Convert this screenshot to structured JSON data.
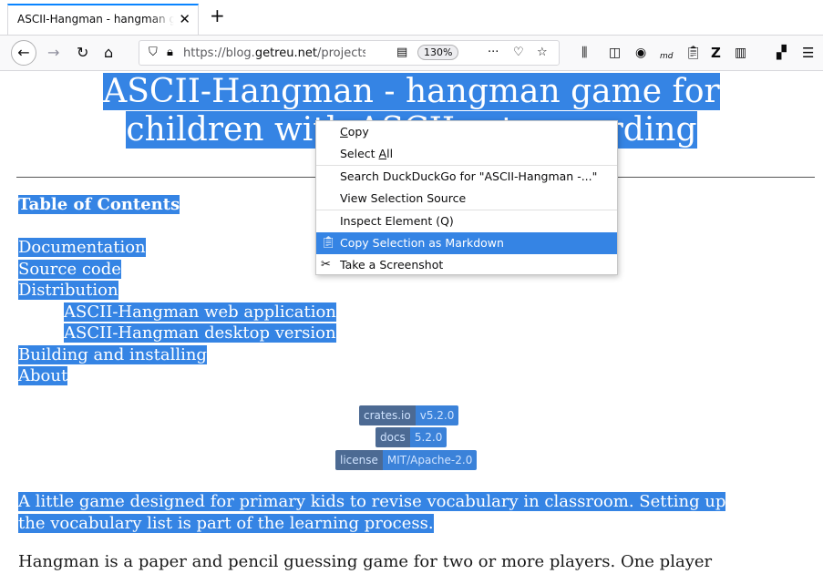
{
  "tab": {
    "title": "ASCII-Hangman - hangman game for children with ASCII-art rewarding"
  },
  "toolbar": {
    "url_prefix": "https://blog.",
    "url_domain": "getreu.net",
    "url_path": "/projects/",
    "zoom": "130%"
  },
  "page": {
    "title_line1": "ASCII-Hangman - hangman game for",
    "title_line2": "children with ASCII-art rewarding",
    "toc_title": "Table of Contents",
    "toc": [
      "Documentation",
      "Source code",
      "Distribution",
      "ASCII-Hangman web application",
      "ASCII-Hangman desktop version",
      "Building and installing",
      "About"
    ],
    "badges": [
      {
        "label": "crates.io",
        "value": "v5.2.0"
      },
      {
        "label": "docs",
        "value": "5.2.0"
      },
      {
        "label": "license",
        "value": "MIT/Apache-2.0"
      }
    ],
    "intro_line1": "A little game designed for primary kids to revise vocabulary in classroom. Setting up",
    "intro_line2": "the vocabulary list is part of the learning process.",
    "para2": "Hangman is a paper and pencil guessing game for two or more players. One player"
  },
  "context_menu": {
    "items": [
      "Copy",
      "Select All",
      "Search DuckDuckGo for \"ASCII-Hangman -...\"",
      "View Selection Source",
      "Inspect Element (Q)",
      "Copy Selection as Markdown",
      "Take a Screenshot"
    ]
  },
  "icons": [
    "back-icon",
    "forward-icon",
    "reload-icon",
    "home-icon",
    "shield-icon",
    "lock-icon",
    "reader-icon",
    "more-icon",
    "pocket-icon",
    "bookmark-star-icon",
    "library-icon",
    "sidebar-icon",
    "account-icon",
    "markdown-icon",
    "clipboard-icon",
    "zotero-icon",
    "grid-icon",
    "extensions-icon",
    "menu-icon",
    "screenshot-icon"
  ],
  "colors": {
    "selection": "#3584e4",
    "tab_accent": "#0a84ff"
  }
}
